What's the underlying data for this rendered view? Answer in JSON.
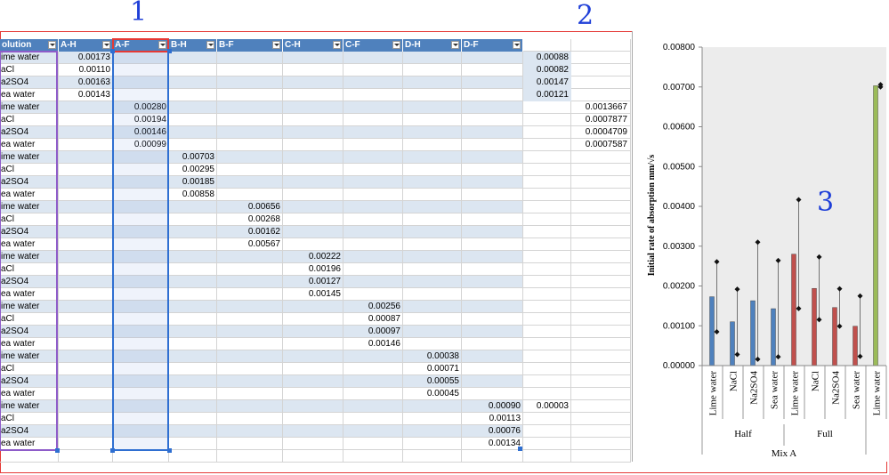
{
  "headers": [
    "olution",
    "A-H",
    "A-F",
    "B-H",
    "B-F",
    "C-H",
    "C-F",
    "D-H",
    "D-F"
  ],
  "row_labels": [
    "ime water",
    "aCl",
    "a2SO4",
    "ea water",
    "ime water",
    "aCl",
    "a2SO4",
    "ea water",
    "ime water",
    "aCl",
    "a2SO4",
    "ea water",
    "ime water",
    "aCl",
    "a2SO4",
    "ea water",
    "ime water",
    "aCl",
    "a2SO4",
    "ea water",
    "ime water",
    "aCl",
    "a2SO4",
    "ea water",
    "ime water",
    "aCl",
    "a2SO4",
    "ea water",
    "ime water",
    "aCl",
    "a2SO4",
    "ea water"
  ],
  "col_values": {
    "A-H": [
      "0.00173",
      "0.00110",
      "0.00163",
      "0.00143"
    ],
    "A-F": [
      "0.00280",
      "0.00194",
      "0.00146",
      "0.00099"
    ],
    "B-H": [
      "0.00703",
      "0.00295",
      "0.00185",
      "0.00858"
    ],
    "B-F": [
      "0.00656",
      "0.00268",
      "0.00162",
      "0.00567"
    ],
    "C-H": [
      "0.00222",
      "0.00196",
      "0.00127",
      "0.00145"
    ],
    "C-F": [
      "0.00256",
      "0.00087",
      "0.00097",
      "0.00146"
    ],
    "D-H": [
      "0.00038",
      "0.00071",
      "0.00055",
      "0.00045"
    ],
    "D-F": [
      "0.00090",
      "0.00113",
      "0.00076",
      "0.00134"
    ]
  },
  "extra_k": [
    "0.00088",
    "0.00082",
    "0.00147",
    "0.00121"
  ],
  "extra_l": [
    "0.0013667",
    "0.0007877",
    "0.0004709",
    "0.0007587"
  ],
  "extra_j29": "0.00003",
  "annotations": [
    "1",
    "2",
    "3"
  ],
  "chart_data": {
    "type": "bar",
    "ylabel": "Initial rate of absorption  mm/√s",
    "ylim": [
      0,
      0.008
    ],
    "yticks": [
      "0.00000",
      "0.00100",
      "0.00200",
      "0.00300",
      "0.00400",
      "0.00500",
      "0.00600",
      "0.00700",
      "0.00800"
    ],
    "categories": [
      "Lime water",
      "NaCl",
      "Na2SO4",
      "Sea water",
      "Lime water",
      "NaCl",
      "Na2SO4",
      "Sea water",
      "Lime water"
    ],
    "group_labels": [
      "Half",
      "Full"
    ],
    "outer_label": "Mix A",
    "values": [
      0.00173,
      0.0011,
      0.00163,
      0.00143,
      0.0028,
      0.00194,
      0.00146,
      0.00099,
      0.00703
    ],
    "colors": [
      "#4f81bd",
      "#4f81bd",
      "#4f81bd",
      "#4f81bd",
      "#c0504d",
      "#c0504d",
      "#c0504d",
      "#c0504d",
      "#9bbb59"
    ],
    "error": [
      0.00088,
      0.00082,
      0.00147,
      0.00121,
      0.0013667,
      0.0007877,
      0.0004709,
      0.0007587,
      3e-05
    ]
  }
}
